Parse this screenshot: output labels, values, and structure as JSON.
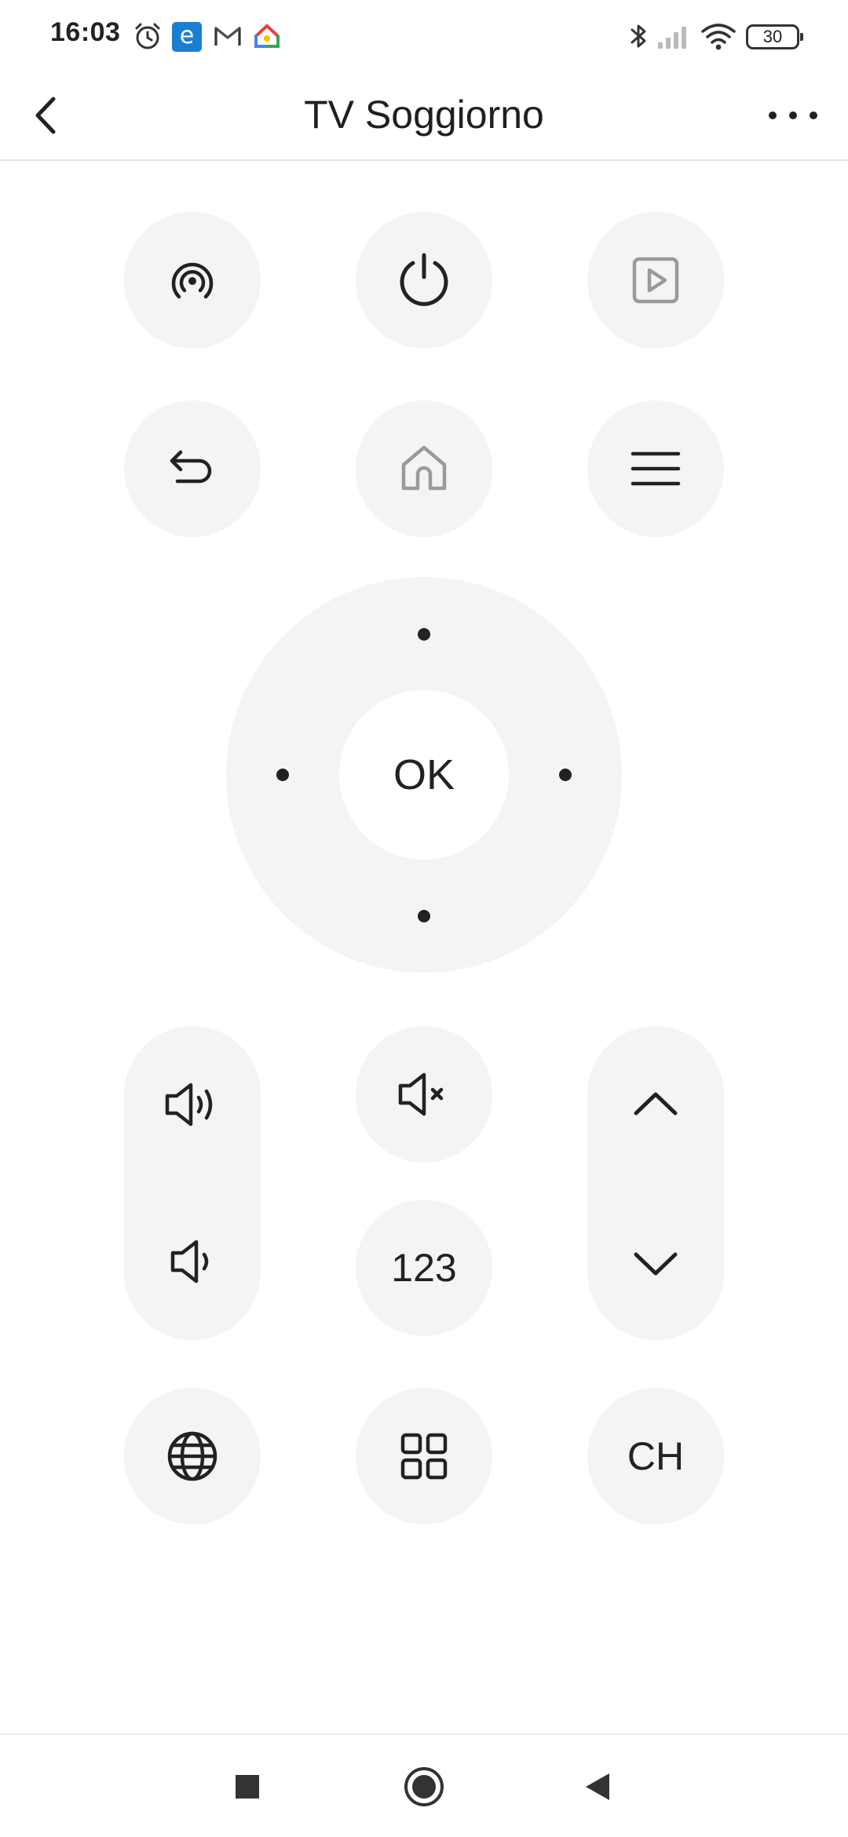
{
  "status_bar": {
    "time": "16:03",
    "battery": "30",
    "icons": [
      "alarm-icon",
      "e-app-icon",
      "gmail-icon",
      "google-home-icon",
      "bluetooth-icon",
      "signal-icon",
      "wifi-icon",
      "battery-icon"
    ],
    "e_label": "e"
  },
  "header": {
    "title": "TV Soggiorno",
    "back_icon": "chevron-left-icon",
    "more_icon": "more-dots-icon"
  },
  "remote": {
    "row1": [
      "cast-icon",
      "power-icon",
      "play-input-icon"
    ],
    "row2": [
      "return-icon",
      "home-icon",
      "menu-icon"
    ],
    "ok_label": "OK",
    "numbers_label": "123",
    "channel_label": "CH",
    "volume_icons": [
      "volume-up-icon",
      "volume-down-icon"
    ],
    "mute_icon": "mute-icon",
    "channel_icons": [
      "channel-up-icon",
      "channel-down-icon"
    ],
    "row_bottom": [
      "globe-icon",
      "apps-grid-icon"
    ]
  },
  "colors": {
    "button_bg": "#f4f4f4",
    "icon": "#222222",
    "icon_muted": "#9a9a9a",
    "accent_blue": "#1b7fd1"
  }
}
